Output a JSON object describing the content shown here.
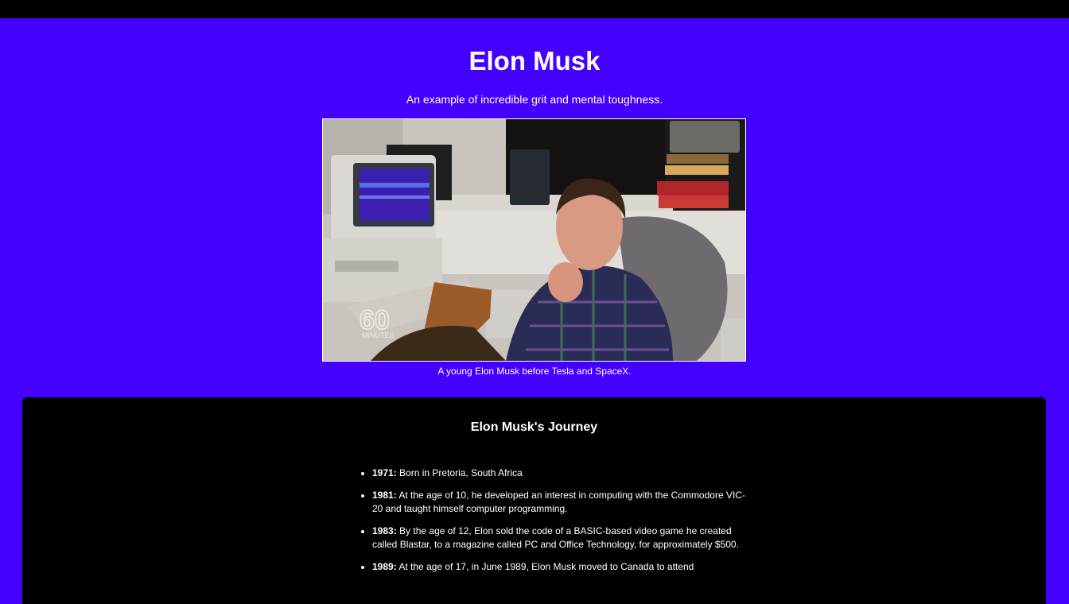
{
  "header": {
    "title": "Elon Musk",
    "tagline": "An example of incredible grit and mental toughness."
  },
  "photo": {
    "overlay_logo_number": "60",
    "overlay_logo_text": "MINUTES"
  },
  "caption": "A young Elon Musk before Tesla and SpaceX.",
  "journey": {
    "title": "Elon Musk's Journey",
    "items": [
      {
        "year": "1971:",
        "text": " Born in Pretoria, South Africa"
      },
      {
        "year": "1981:",
        "text": " At the age of 10, he developed an interest in computing with the Commodore VIC-20 and taught himself computer programming."
      },
      {
        "year": "1983:",
        "text": " By the age of 12, Elon sold the code of a BASIC-based video game he created called Blastar, to a magazine called PC and Office Technology, for approximately $500."
      },
      {
        "year": "1989:",
        "text": " At the age of 17, in June 1989, Elon Musk moved to Canada to attend"
      }
    ]
  },
  "colors": {
    "page_background": "#4400ff",
    "top_bar": "#000000",
    "panel_background": "#000000",
    "text": "#ffffff"
  }
}
